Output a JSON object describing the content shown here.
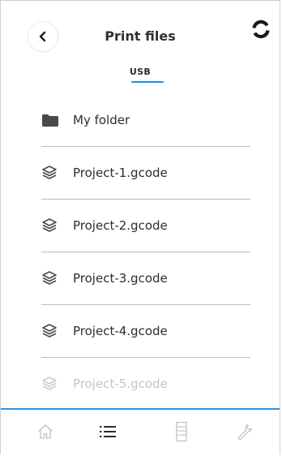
{
  "header": {
    "title": "Print files",
    "back_icon": "chevron-left-icon",
    "sync_icon": "sync-icon"
  },
  "tabs": [
    {
      "label": "USB",
      "active": true
    }
  ],
  "files": [
    {
      "name": "My folder",
      "type": "folder",
      "icon": "folder-icon"
    },
    {
      "name": "Project-1.gcode",
      "type": "gcode",
      "icon": "layers-icon"
    },
    {
      "name": "Project-2.gcode",
      "type": "gcode",
      "icon": "layers-icon"
    },
    {
      "name": "Project-3.gcode",
      "type": "gcode",
      "icon": "layers-icon"
    },
    {
      "name": "Project-4.gcode",
      "type": "gcode",
      "icon": "layers-icon"
    },
    {
      "name": "Project-5.gcode",
      "type": "gcode",
      "icon": "layers-icon"
    }
  ],
  "nav": {
    "items": [
      {
        "id": "home",
        "icon": "home-icon",
        "active": false
      },
      {
        "id": "files",
        "icon": "list-icon",
        "active": true
      },
      {
        "id": "printer",
        "icon": "printer-icon",
        "active": false
      },
      {
        "id": "tools",
        "icon": "wrench-icon",
        "active": false
      }
    ]
  },
  "colors": {
    "accent": "#1a8fe0",
    "text": "#2d2d2d",
    "divider": "#bdbdbd",
    "inactive_icon": "#c8c8c8"
  }
}
